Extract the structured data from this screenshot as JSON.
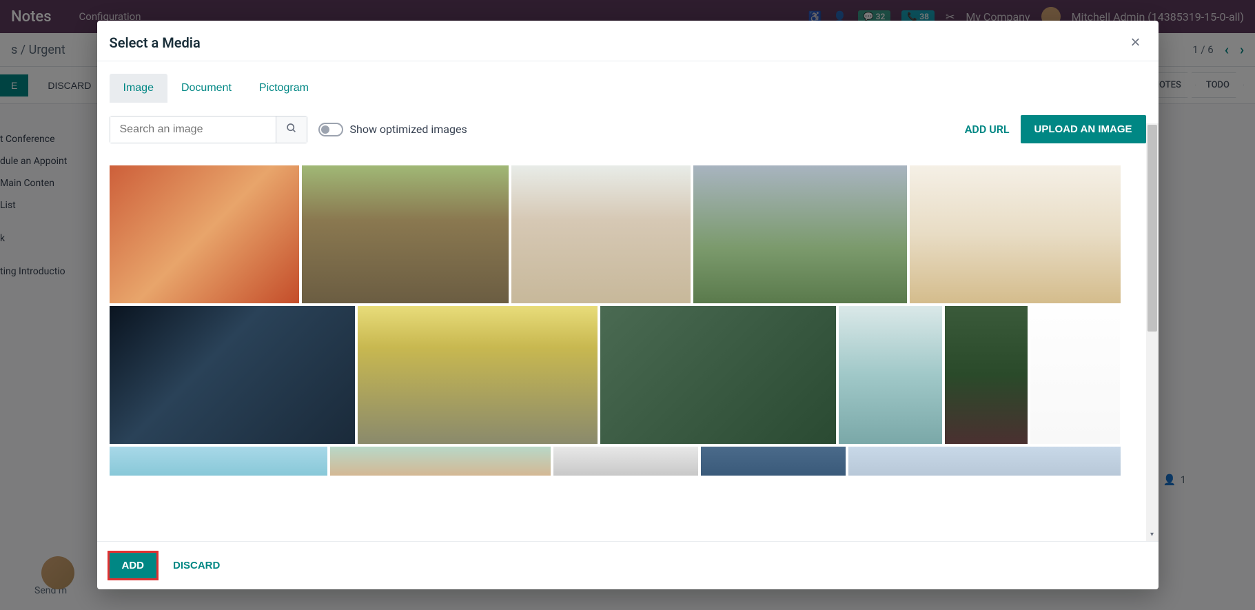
{
  "header": {
    "app_title": "Notes",
    "menu_item": "Configuration",
    "badge1": "32",
    "badge2": "38",
    "company": "My Company",
    "user": "Mitchell Admin (14385319-15-0-all)"
  },
  "breadcrumb": {
    "parent": "s",
    "current": "Urgent",
    "counter": "1 / 6"
  },
  "actions": {
    "save": "E",
    "discard": "DISCARD"
  },
  "status": {
    "tab1": "NOTES",
    "tab2": "TODO"
  },
  "sidebar": {
    "item1": "t Conference",
    "item2": "dule an Appoint",
    "item3": "Main Conten",
    "item4": "List",
    "item5": "k",
    "item6": "ting Introductio"
  },
  "bottom": {
    "send": "Send m",
    "followers": "1"
  },
  "modal": {
    "title": "Select a Media",
    "tabs": {
      "image": "Image",
      "document": "Document",
      "pictogram": "Pictogram"
    },
    "search": {
      "placeholder": "Search an image"
    },
    "toggle": "Show optimized images",
    "add_url": "ADD URL",
    "upload": "UPLOAD AN IMAGE",
    "footer": {
      "add": "ADD",
      "discard": "DISCARD"
    }
  }
}
